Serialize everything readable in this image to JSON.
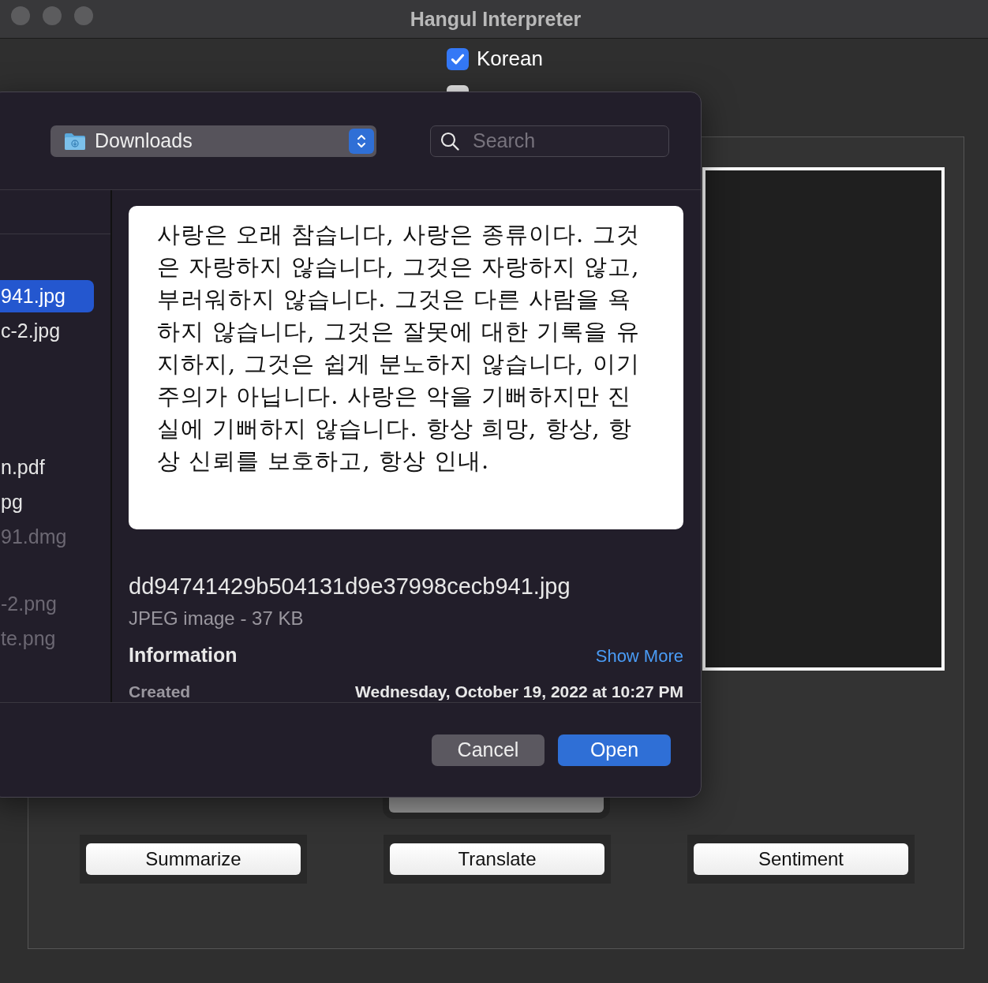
{
  "window": {
    "title": "Hangul Interpreter"
  },
  "languages": [
    {
      "label": "Korean",
      "checked": true
    },
    {
      "checked": false
    }
  ],
  "actions": [
    "Summarize",
    "Translate",
    "Sentiment"
  ],
  "dialog": {
    "location": "Downloads",
    "search": {
      "placeholder": "Search"
    },
    "files": [
      {
        "name": "941.jpg",
        "selected": true,
        "disabled": false
      },
      {
        "name": "c-2.jpg",
        "selected": false,
        "disabled": false
      },
      {
        "name": "n.pdf",
        "selected": false,
        "disabled": false
      },
      {
        "name": "pg",
        "selected": false,
        "disabled": false
      },
      {
        "name": "91.dmg",
        "selected": false,
        "disabled": true
      },
      {
        "name": "-2.png",
        "selected": false,
        "disabled": true
      },
      {
        "name": "te.png",
        "selected": false,
        "disabled": true
      }
    ],
    "preview": {
      "text": "사랑은 오래 참습니다, 사랑은 종류이다. 그것은 자랑하지 않습니다, 그것은 자랑하지 않고, 부러워하지 않습니다. 그것은 다른 사람을 욕하지 않습니다, 그것은 잘못에 대한 기록을 유지하지, 그것은 쉽게 분노하지 않습니다, 이기주의가 아닙니다. 사랑은 악을 기뻐하지만 진실에 기뻐하지 않습니다. 항상 희망, 항상, 항상 신뢰를 보호하고, 항상 인내.",
      "filename": "dd94741429b504131d9e37998cecb941.jpg",
      "kind_size": "JPEG image - 37 KB"
    },
    "information": {
      "title": "Information",
      "show_more": "Show More",
      "rows": [
        {
          "label": "Created",
          "value": "Wednesday, October 19, 2022 at 10:27 PM"
        }
      ]
    },
    "buttons": [
      {
        "label": "Cancel",
        "kind": "secondary"
      },
      {
        "label": "Open",
        "kind": "primary"
      }
    ]
  }
}
